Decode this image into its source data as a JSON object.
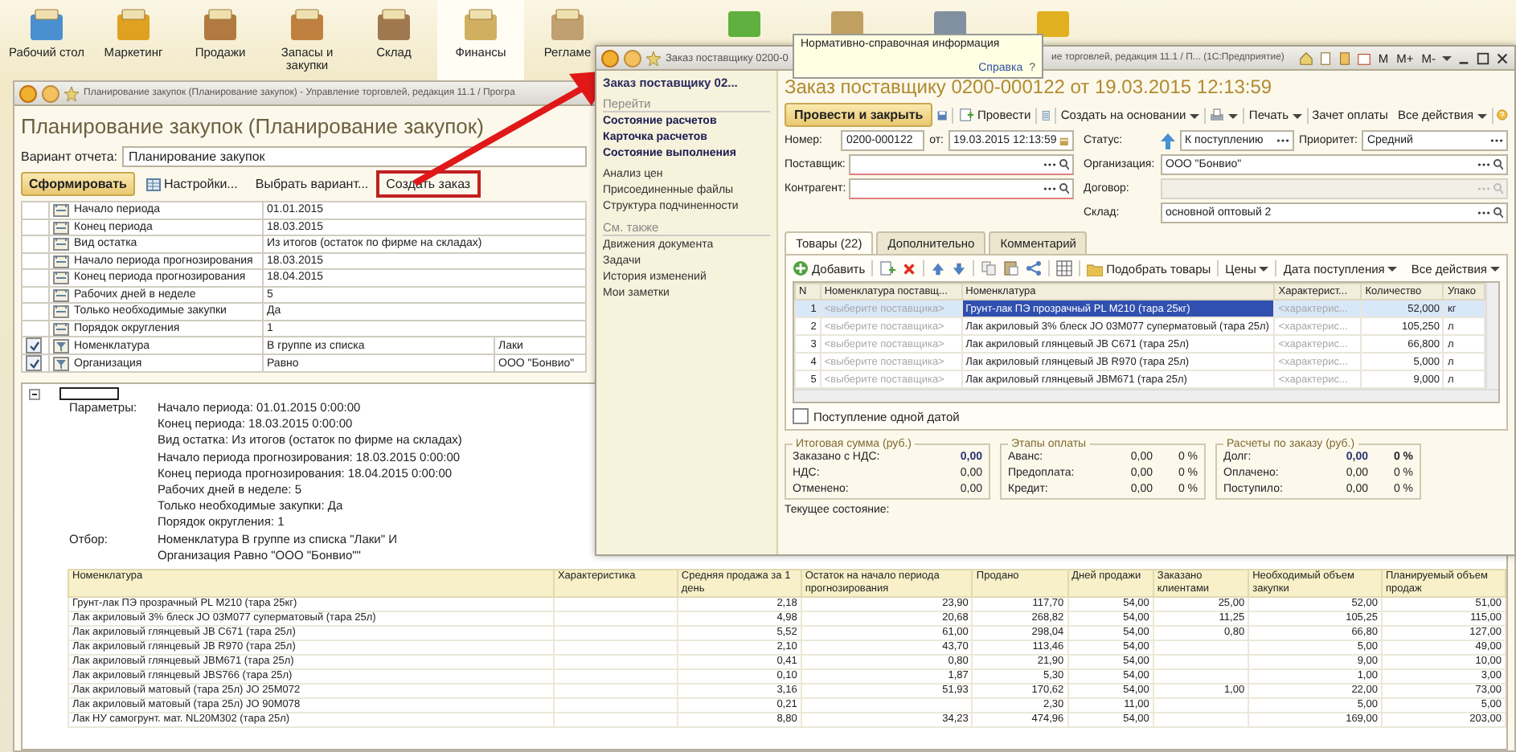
{
  "sections_panel": {
    "sections": [
      {
        "label": "Рабочий стол",
        "selected": false
      },
      {
        "label": "Маркетинг",
        "selected": false
      },
      {
        "label": "Продажи",
        "selected": false
      },
      {
        "label": "Запасы и закупки",
        "selected": false
      },
      {
        "label": "Склад",
        "selected": false
      },
      {
        "label": "Финансы",
        "selected": true
      },
      {
        "label": "Регламе",
        "selected": false
      }
    ]
  },
  "tooltip": {
    "text": "Нормативно-справочная информация",
    "link": "Справка",
    "help": "?"
  },
  "report_window": {
    "title": "Планирование закупок (Планирование закупок) - Управление торговлей, редакция 11.1 / Програ",
    "heading": "Планирование закупок (Планирование закупок)",
    "variant_label": "Вариант отчета:",
    "variant_value": "Планирование закупок",
    "toolbar": [
      {
        "label": "Сформировать",
        "kind": "primary",
        "highlighted": false
      },
      {
        "label": "Настройки...",
        "kind": "settings",
        "highlighted": false
      },
      {
        "label": "Выбрать вариант...",
        "kind": "plain",
        "highlighted": false
      },
      {
        "label": "Создать заказ",
        "kind": "plain",
        "highlighted": true
      }
    ],
    "settings": [
      {
        "kind": "param",
        "name": "Начало периода",
        "value": "01.01.2015"
      },
      {
        "kind": "param",
        "name": "Конец периода",
        "value": "18.03.2015"
      },
      {
        "kind": "param",
        "name": "Вид остатка",
        "value": "Из итогов (остаток по фирме на складах)"
      },
      {
        "kind": "param",
        "name": "Начало периода прогнозирования",
        "value": "18.03.2015"
      },
      {
        "kind": "param",
        "name": "Конец периода прогнозирования",
        "value": "18.04.2015"
      },
      {
        "kind": "param",
        "name": "Рабочих дней в неделе",
        "value": "5"
      },
      {
        "kind": "param",
        "name": "Только необходимые закупки",
        "value": "Да"
      },
      {
        "kind": "param",
        "name": "Порядок округления",
        "value": "1"
      },
      {
        "kind": "filter",
        "checked": true,
        "name": "Номенклатура",
        "condition": "В группе из списка",
        "value": "Лаки"
      },
      {
        "kind": "filter",
        "checked": true,
        "name": "Организация",
        "condition": "Равно",
        "value": "ООО \"Бонвио\""
      }
    ],
    "report": {
      "parameters_label": "Параметры:",
      "parameters": [
        "Начало периода: 01.01.2015 0:00:00",
        "Конец периода: 18.03.2015 0:00:00",
        "Вид остатка: Из итогов (остаток по фирме на складах)",
        "Начало периода прогнозирования: 18.03.2015 0:00:00",
        "Конец периода прогнозирования: 18.04.2015 0:00:00",
        "Рабочих дней в неделе: 5",
        "Только необходимые закупки: Да",
        "Порядок округления: 1"
      ],
      "filter_label": "Отбор:",
      "filter": [
        "Номенклатура В группе из списка \"Лаки\" И",
        "Организация Равно \"ООО \"Бонвио\"\""
      ],
      "table": {
        "columns": [
          "Номенклатура",
          "Характеристика",
          "Средняя продажа за 1 день",
          "Остаток на начало периода прогнозирования",
          "Продано",
          "Дней продажи",
          "Заказано клиентами",
          "Необходимый объем закупки",
          "Планируемый объем продаж"
        ],
        "rows": [
          [
            "Грунт-лак ПЭ прозрачный PL M210 (тара 25кг)",
            null,
            "2,18",
            "23,90",
            "117,70",
            "54,00",
            "25,00",
            "52,00",
            "51,00"
          ],
          [
            "Лак акриловый 3% блеск JO 03M077 суперматовый (тара 25л)",
            null,
            "4,98",
            "20,68",
            "268,82",
            "54,00",
            "11,25",
            "105,25",
            "115,00"
          ],
          [
            "Лак акриловый глянцевый JB C671 (тара 25л)",
            null,
            "5,52",
            "61,00",
            "298,04",
            "54,00",
            "0,80",
            "66,80",
            "127,00"
          ],
          [
            "Лак акриловый глянцевый JB R970 (тара 25л)",
            null,
            "2,10",
            "43,70",
            "113,46",
            "54,00",
            null,
            "5,00",
            "49,00"
          ],
          [
            "Лак акриловый глянцевый JBM671 (тара 25л)",
            null,
            "0,41",
            "0,80",
            "21,90",
            "54,00",
            null,
            "9,00",
            "10,00"
          ],
          [
            "Лак акриловый глянцевый JBS766 (тара 25л)",
            null,
            "0,10",
            "1,87",
            "5,30",
            "54,00",
            null,
            "1,00",
            "3,00"
          ],
          [
            "Лак акриловый матовый (тара 25л) JO 25M072",
            null,
            "3,16",
            "51,93",
            "170,62",
            "54,00",
            "1,00",
            "22,00",
            "73,00"
          ],
          [
            "Лак акриловый матовый (тара 25л) JO 90M078",
            null,
            "0,21",
            null,
            "2,30",
            "11,00",
            null,
            "5,00",
            "5,00"
          ],
          [
            "Лак НУ самогрунт. мат. NL20M302 (тара 25л)",
            null,
            "8,80",
            "34,23",
            "474,96",
            "54,00",
            null,
            "169,00",
            "203,00"
          ]
        ]
      }
    }
  },
  "order_window": {
    "title_left": "Заказ поставщику 0200-0",
    "title_right": "ие торговлей, редакция 11.1 / П...  (1С:Предприятие)",
    "title_buttons": [
      "M",
      "M+",
      "M-"
    ],
    "nav": {
      "current": "Заказ поставщику 02...",
      "groups": [
        {
          "heading": "Перейти",
          "links": [
            {
              "label": "Состояние расчетов",
              "bold": true
            },
            {
              "label": "Карточка расчетов",
              "bold": true
            },
            {
              "label": "Состояние выполнения",
              "bold": true
            }
          ]
        },
        {
          "links": [
            {
              "label": "Анализ цен",
              "bold": false
            },
            {
              "label": "Присоединенные файлы",
              "bold": false
            },
            {
              "label": "Структура подчиненности",
              "bold": false
            }
          ]
        },
        {
          "heading": "См. также",
          "links": [
            {
              "label": "Движения документа",
              "bold": false
            },
            {
              "label": "Задачи",
              "bold": false
            },
            {
              "label": "История изменений",
              "bold": false
            },
            {
              "label": "Мои заметки",
              "bold": false
            }
          ]
        }
      ]
    },
    "heading": "Заказ поставщику 0200-000122 от 19.03.2015 12:13:59",
    "toolbar": {
      "post_close": "Провести и закрыть",
      "post": "Провести",
      "create_based": "Создать на основании",
      "print": "Печать",
      "offset": "Зачет оплаты",
      "all_actions": "Все действия"
    },
    "fields": {
      "number": {
        "label": "Номер:",
        "value": "0200-000122"
      },
      "date": {
        "label": "от:",
        "value": "19.03.2015 12:13:59"
      },
      "status": {
        "label": "Статус:",
        "value": "К поступлению"
      },
      "priority": {
        "label": "Приоритет:",
        "value": "Средний"
      },
      "supplier": {
        "label": "Поставщик:"
      },
      "counterparty": {
        "label": "Контрагент:"
      },
      "organization": {
        "label": "Организация:",
        "value": "ООО \"Бонвио\""
      },
      "contract": {
        "label": "Договор:",
        "disabled": true
      },
      "warehouse": {
        "label": "Склад:",
        "value": "основной оптовый 2"
      }
    },
    "tabs": [
      {
        "label": "Товары (22)",
        "selected": true
      },
      {
        "label": "Дополнительно",
        "selected": false
      },
      {
        "label": "Комментарий",
        "selected": false
      }
    ],
    "items_toolbar": {
      "add": "Добавить",
      "pick": "Подобрать товары",
      "prices": "Цены",
      "arrival_date": "Дата поступления",
      "all_actions": "Все действия"
    },
    "items": {
      "columns": [
        "N",
        "Номенклатура поставщ...",
        "Номенклатура",
        "Характерист...",
        "Количество",
        "Упако"
      ],
      "rows": [
        {
          "n": "1",
          "supplier_item": "<выберите поставщика>",
          "item": "Грунт-лак ПЭ прозрачный PL M210 (тара 25кг)",
          "characteristic": "<характерис...",
          "quantity": "52,000",
          "unit": "кг",
          "selected": true
        },
        {
          "n": "2",
          "supplier_item": "<выберите поставщика>",
          "item": "Лак акриловый 3% блеск JO 03M077 суперматовый (тара 25л)",
          "characteristic": "<характерис...",
          "quantity": "105,250",
          "unit": "л",
          "selected": false
        },
        {
          "n": "3",
          "supplier_item": "<выберите поставщика>",
          "item": "Лак акриловый глянцевый JB C671 (тара 25л)",
          "characteristic": "<характерис...",
          "quantity": "66,800",
          "unit": "л",
          "selected": false
        },
        {
          "n": "4",
          "supplier_item": "<выберите поставщика>",
          "item": "Лак акриловый глянцевый JB R970 (тара 25л)",
          "characteristic": "<характерис...",
          "quantity": "5,000",
          "unit": "л",
          "selected": false
        },
        {
          "n": "5",
          "supplier_item": "<выберите поставщика>",
          "item": "Лак акриловый глянцевый JBM671 (тара 25л)",
          "characteristic": "<характерис...",
          "quantity": "9,000",
          "unit": "л",
          "selected": false
        }
      ]
    },
    "single_date": {
      "label": "Поступление одной датой",
      "checked": false
    },
    "totals": [
      {
        "title": "Итоговая сумма (руб.)",
        "rows": [
          {
            "label": "Заказано с НДС:",
            "value": "0,00",
            "bold": true
          },
          {
            "label": "НДС:",
            "value": "0,00",
            "bold": false
          },
          {
            "label": "Отменено:",
            "value": "0,00",
            "bold": false
          }
        ]
      },
      {
        "title": "Этапы оплаты",
        "rows": [
          {
            "label": "Аванс:",
            "value": "0,00",
            "percent": "0 %",
            "bold": false
          },
          {
            "label": "Предоплата:",
            "value": "0,00",
            "percent": "0 %",
            "bold": false
          },
          {
            "label": "Кредит:",
            "value": "0,00",
            "percent": "0 %",
            "bold": false
          }
        ]
      },
      {
        "title": "Расчеты по заказу (руб.)",
        "rows": [
          {
            "label": "Долг:",
            "value": "0,00",
            "percent": "0 %",
            "bold": true
          },
          {
            "label": "Оплачено:",
            "value": "0,00",
            "percent": "0 %",
            "bold": false
          },
          {
            "label": "Поступило:",
            "value": "0,00",
            "percent": "0 %",
            "bold": false
          }
        ]
      }
    ],
    "current_state_label": "Текущее состояние:"
  }
}
